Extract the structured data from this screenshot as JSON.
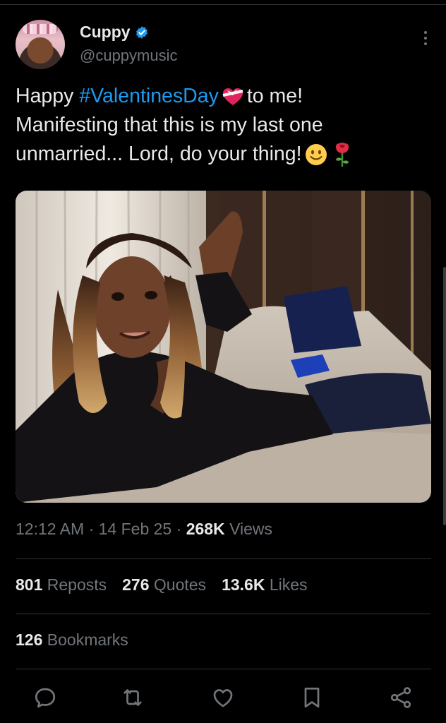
{
  "user": {
    "display_name": "Cuppy",
    "handle": "@cuppymusic",
    "verified": true,
    "avatar_icon": "profile-photo"
  },
  "tweet": {
    "line1_pre": "Happy ",
    "hashtag": "#ValentinesDay",
    "line1_post": "to me!",
    "line2": "Manifesting that this is my last one",
    "line3": "unmarried... Lord, do your thing!",
    "emojis": [
      "heart-with-ribbon",
      "slightly-smiling-face",
      "rose"
    ]
  },
  "meta": {
    "time": "12:12 AM",
    "sep": "·",
    "date": "14 Feb 25",
    "views_count": "268K",
    "views_label": "Views"
  },
  "stats": {
    "reposts_count": "801",
    "reposts_label": "Reposts",
    "quotes_count": "276",
    "quotes_label": "Quotes",
    "likes_count": "13.6K",
    "likes_label": "Likes",
    "bookmarks_count": "126",
    "bookmarks_label": "Bookmarks"
  },
  "actions": [
    "reply-icon",
    "repost-icon",
    "like-icon",
    "bookmark-icon",
    "share-icon"
  ],
  "colors": {
    "background": "#000000",
    "text": "#e7e9ea",
    "muted": "#71767b",
    "link": "#1d9bf0",
    "verified": "#1d9bf0",
    "divider": "#2f3336"
  }
}
